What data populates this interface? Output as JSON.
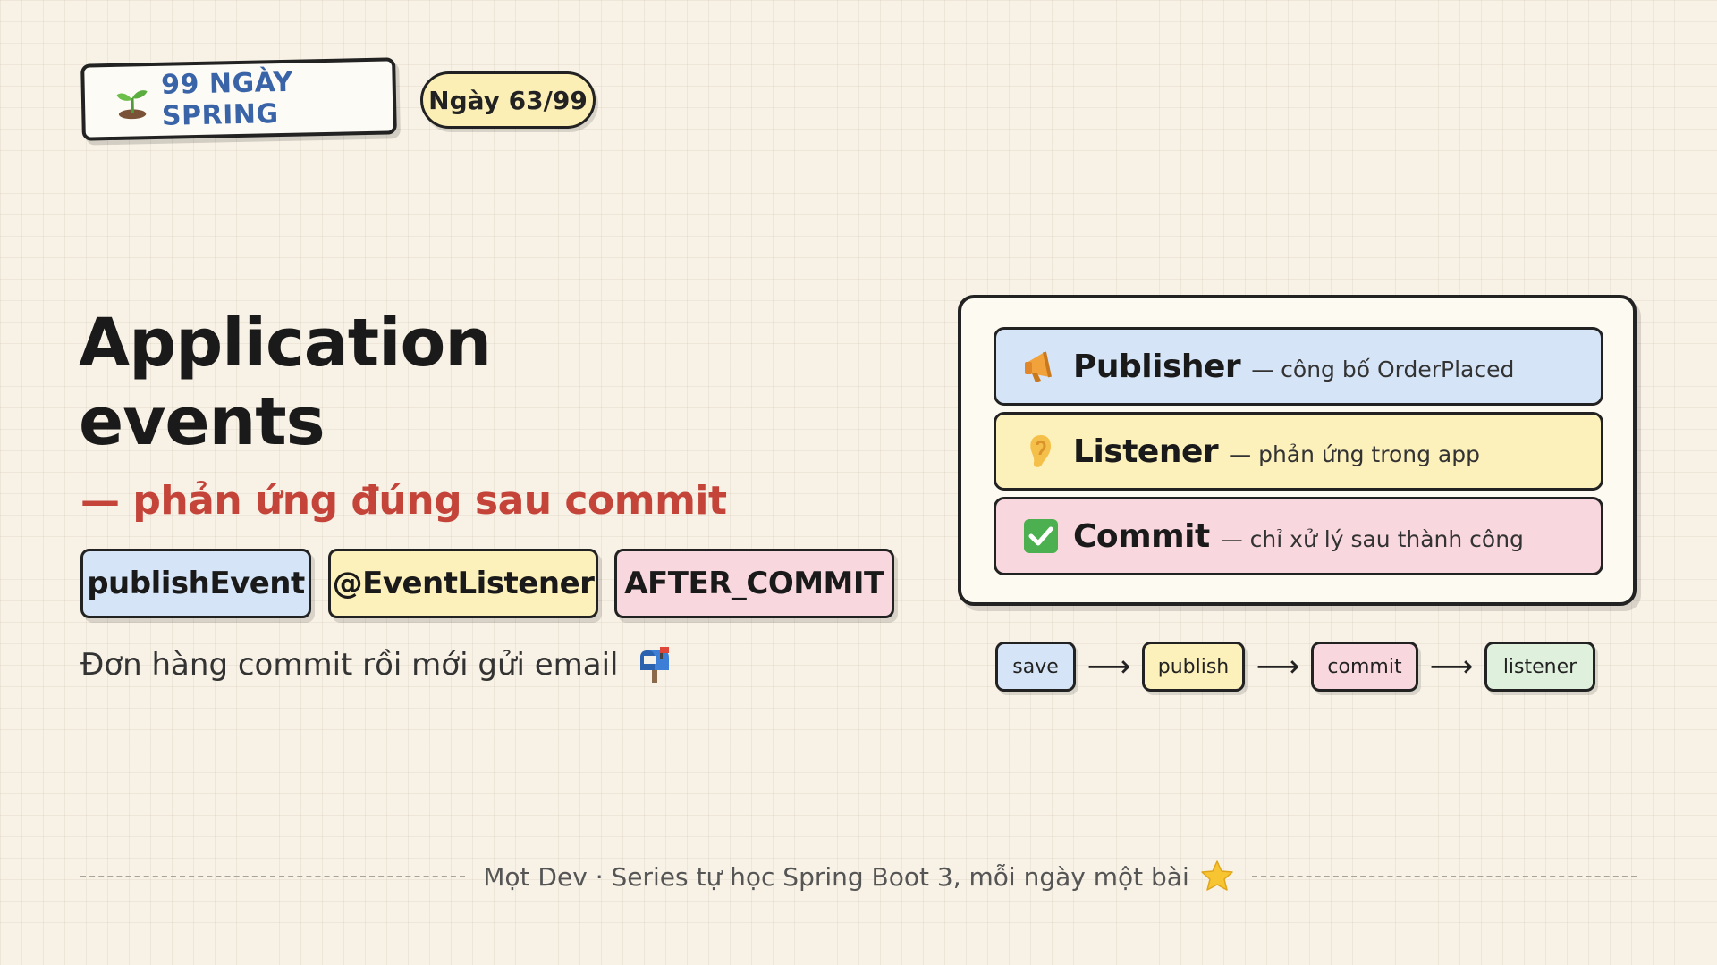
{
  "header": {
    "series_badge": {
      "icon": "sprout-icon",
      "label": "99 NGÀY SPRING"
    },
    "day_pill": "Ngày 63/99"
  },
  "title": {
    "line1": "Application",
    "line2": "events"
  },
  "subtitle": "— phản ứng đúng sau commit",
  "tags": [
    "publishEvent",
    "@EventListener",
    "AFTER_COMMIT"
  ],
  "caption": {
    "text": "Đơn hàng commit rồi mới gửi email",
    "icon": "mailbox-icon"
  },
  "roles": [
    {
      "icon": "megaphone-icon",
      "name": "Publisher",
      "desc": "— công bố OrderPlaced"
    },
    {
      "icon": "ear-icon",
      "name": "Listener",
      "desc": "— phản ứng trong app"
    },
    {
      "icon": "check-box-icon",
      "name": "Commit",
      "desc": "— chỉ xử lý sau thành công"
    }
  ],
  "flow": {
    "steps": [
      "save",
      "publish",
      "commit",
      "listener"
    ],
    "arrow": "⟶"
  },
  "footer": {
    "text": "Mọt Dev · Series tự học Spring Boot 3, mỗi ngày một bài",
    "icon": "star-icon"
  },
  "colors": {
    "blue": "#d5e5f7",
    "yellow": "#fcf0bb",
    "pink": "#f8d7de",
    "green": "#dff0dc",
    "accent_red": "#c4443a",
    "badge_blue": "#3a64a8"
  }
}
